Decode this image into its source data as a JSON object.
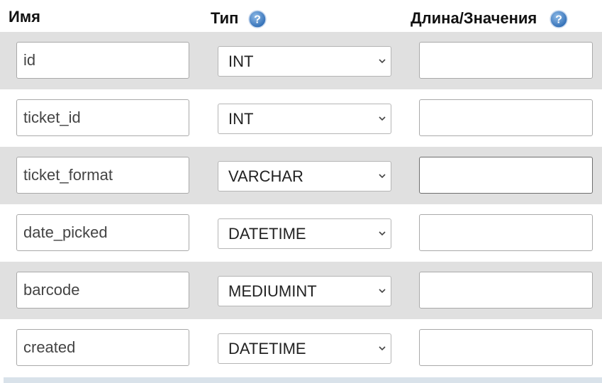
{
  "header": {
    "name_label": "Имя",
    "type_label": "Тип",
    "length_label": "Длина/Значения",
    "help_icon": "question-circle-icon"
  },
  "colors": {
    "row_shade": "#e0e0e0",
    "help_icon_blue": "#3f7fc7"
  },
  "rows": [
    {
      "name": "id",
      "type": "INT",
      "length": ""
    },
    {
      "name": "ticket_id",
      "type": "INT",
      "length": ""
    },
    {
      "name": "ticket_format",
      "type": "VARCHAR",
      "length": ""
    },
    {
      "name": "date_picked",
      "type": "DATETIME",
      "length": ""
    },
    {
      "name": "barcode",
      "type": "MEDIUMINT",
      "length": ""
    },
    {
      "name": "created",
      "type": "DATETIME",
      "length": ""
    }
  ]
}
